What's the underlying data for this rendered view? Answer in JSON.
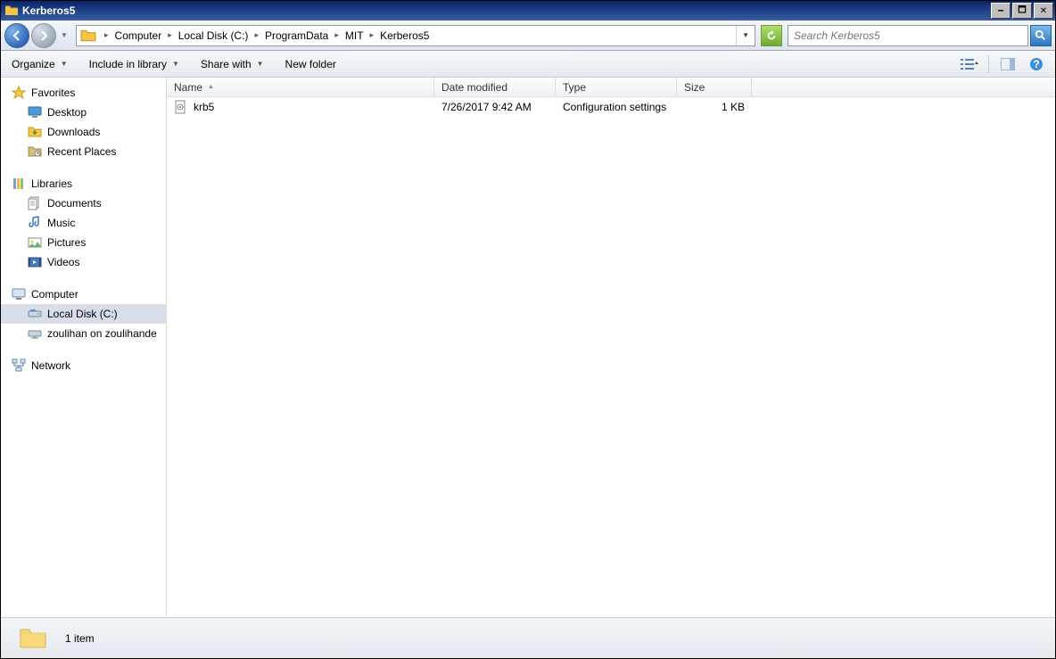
{
  "window": {
    "title": "Kerberos5"
  },
  "breadcrumbs": [
    "Computer",
    "Local Disk (C:)",
    "ProgramData",
    "MIT",
    "Kerberos5"
  ],
  "search": {
    "placeholder": "Search Kerberos5"
  },
  "toolbar": {
    "organize": "Organize",
    "include": "Include in library",
    "share": "Share with",
    "newfolder": "New folder"
  },
  "sidebar": {
    "favorites": {
      "label": "Favorites",
      "items": [
        {
          "icon": "desktop",
          "label": "Desktop"
        },
        {
          "icon": "downloads",
          "label": "Downloads"
        },
        {
          "icon": "recent",
          "label": "Recent Places"
        }
      ]
    },
    "libraries": {
      "label": "Libraries",
      "items": [
        {
          "icon": "documents",
          "label": "Documents"
        },
        {
          "icon": "music",
          "label": "Music"
        },
        {
          "icon": "pictures",
          "label": "Pictures"
        },
        {
          "icon": "videos",
          "label": "Videos"
        }
      ]
    },
    "computer": {
      "label": "Computer",
      "items": [
        {
          "icon": "disk",
          "label": "Local Disk (C:)",
          "selected": true
        },
        {
          "icon": "netdrive",
          "label": "zoulihan on zoulihande"
        }
      ]
    },
    "network": {
      "label": "Network"
    }
  },
  "columns": {
    "name": "Name",
    "date": "Date modified",
    "type": "Type",
    "size": "Size"
  },
  "files": [
    {
      "name": "krb5",
      "date": "7/26/2017 9:42 AM",
      "type": "Configuration settings",
      "size": "1 KB"
    }
  ],
  "status": {
    "count": "1 item"
  }
}
